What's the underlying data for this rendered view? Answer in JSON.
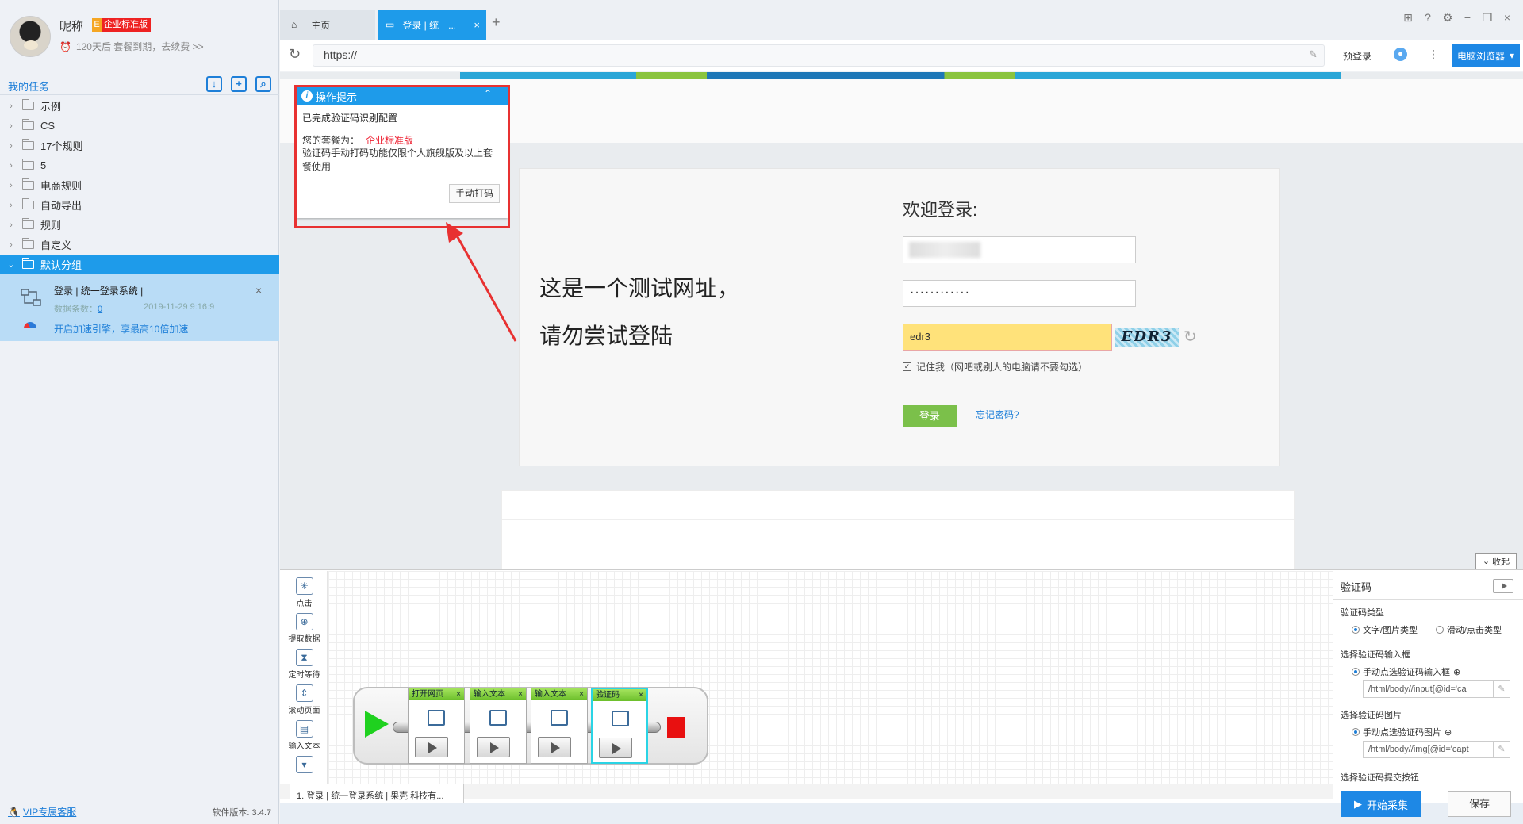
{
  "user": {
    "nickname": "昵称",
    "badge_e": "E",
    "badge": "企业标准版",
    "expire": "120天后 套餐到期，去续费 >>"
  },
  "sidebar": {
    "title": "我的任务",
    "items": [
      {
        "label": "示例"
      },
      {
        "label": "CS"
      },
      {
        "label": "17个规则"
      },
      {
        "label": "5"
      },
      {
        "label": "电商规则"
      },
      {
        "label": "自动导出"
      },
      {
        "label": "规则"
      },
      {
        "label": "自定义"
      },
      {
        "label": "默认分组",
        "selected": true
      }
    ],
    "task": {
      "name": "登录 | 统一登录系统 |",
      "count_label": "数据条数：",
      "count": "0",
      "date": "2019-11-29 9:16:9",
      "boost": "开启加速引擎，享最高10倍加速"
    },
    "vip": "VIP专属客服",
    "version": "软件版本: 3.4.7"
  },
  "tabs": {
    "home": "主页",
    "active": "登录 | 统一...",
    "close": "×",
    "new": "+"
  },
  "address": {
    "url": "https://",
    "prelogin": "预登录",
    "browser": "电脑浏览器"
  },
  "webpage": {
    "welcome": "欢迎登录:",
    "password": "············",
    "captcha_value": "edr3",
    "captcha_image_text": "EDR3",
    "remember": "记住我（网吧或别人的电脑请不要勾选）",
    "login": "登录",
    "forgot": "忘记密码?",
    "note_line1": "这是一个测试网址，",
    "note_line2": "请勿尝试登陆"
  },
  "tip": {
    "title": "操作提示",
    "line1": "已完成验证码识别配置",
    "plan_label": "您的套餐为：",
    "plan": "企业标准版",
    "line3": "验证码手动打码功能仅限个人旗舰版及以上套餐使用",
    "button": "手动打码"
  },
  "designer": {
    "collapse": "收起",
    "tools": [
      "点击",
      "提取数据",
      "定时等待",
      "滚动页面",
      "输入文本"
    ],
    "steps": [
      {
        "label": "打开网页"
      },
      {
        "label": "输入文本"
      },
      {
        "label": "输入文本"
      },
      {
        "label": "验证码"
      }
    ],
    "flow_tab": "1. 登录 | 统一登录系统 | 果壳 科技有..."
  },
  "props": {
    "title": "验证码",
    "type_label": "验证码类型",
    "type_opt1": "文字/图片类型",
    "type_opt2": "滑动/点击类型",
    "input_label": "选择验证码输入框",
    "input_opt": "手动点选验证码输入框",
    "input_xpath": "/html/body//input[@id='ca",
    "image_label": "选择验证码图片",
    "image_opt": "手动点选验证码图片",
    "image_xpath": "/html/body//img[@id='capt",
    "submit_label": "选择验证码提交按钮"
  },
  "actions": {
    "start": "开始采集",
    "save": "保存"
  }
}
